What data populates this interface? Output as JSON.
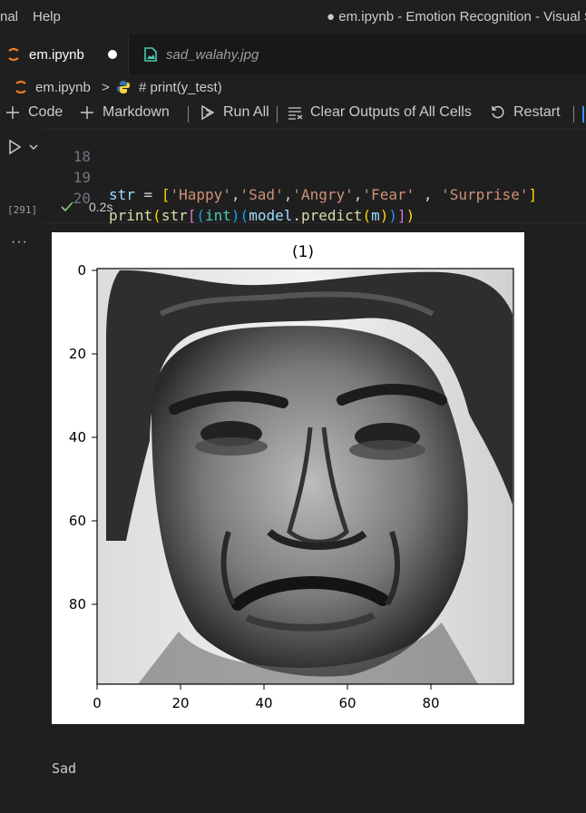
{
  "window": {
    "menu_partial": "nal",
    "menu_help": "Help",
    "title": "● em.ipynb - Emotion Recognition - Visual S"
  },
  "tabs": [
    {
      "label": "em.ipynb",
      "icon": "jupyter-icon",
      "dirty": true
    },
    {
      "label": "sad_walahy.jpg",
      "icon": "image-file-icon"
    }
  ],
  "breadcrumb": {
    "file": "em.ipynb",
    "separator": ">",
    "symbol": "# print(y_test)"
  },
  "toolbar": {
    "code_label": "Code",
    "markdown_label": "Markdown",
    "run_all_label": "Run All",
    "clear_label": "Clear Outputs of All Cells",
    "restart_label": "Restart"
  },
  "cell": {
    "execution_count": "[291]",
    "duration": "0.2s",
    "lines": [
      {
        "num": "18"
      },
      {
        "num": "19"
      },
      {
        "num": "20"
      }
    ],
    "code": {
      "l19_var": "str",
      "l19_eq": " = ",
      "l19_open": "[",
      "l19_s1": "'Happy'",
      "l19_s2": "'Sad'",
      "l19_s3": "'Angry'",
      "l19_s4": "'Fear'",
      "l19_s5": "'Surprise'",
      "l19_close": "]",
      "l20_print": "print",
      "l20_str": "str",
      "l20_int": "int",
      "l20_model": "model",
      "l20_predict": "predict",
      "l20_m": "m"
    }
  },
  "figure": {
    "title": "(1)",
    "x_ticks": [
      "0",
      "20",
      "40",
      "60",
      "80"
    ],
    "y_ticks": [
      "0",
      "20",
      "40",
      "60",
      "80"
    ]
  },
  "output": {
    "text": "Sad"
  }
}
